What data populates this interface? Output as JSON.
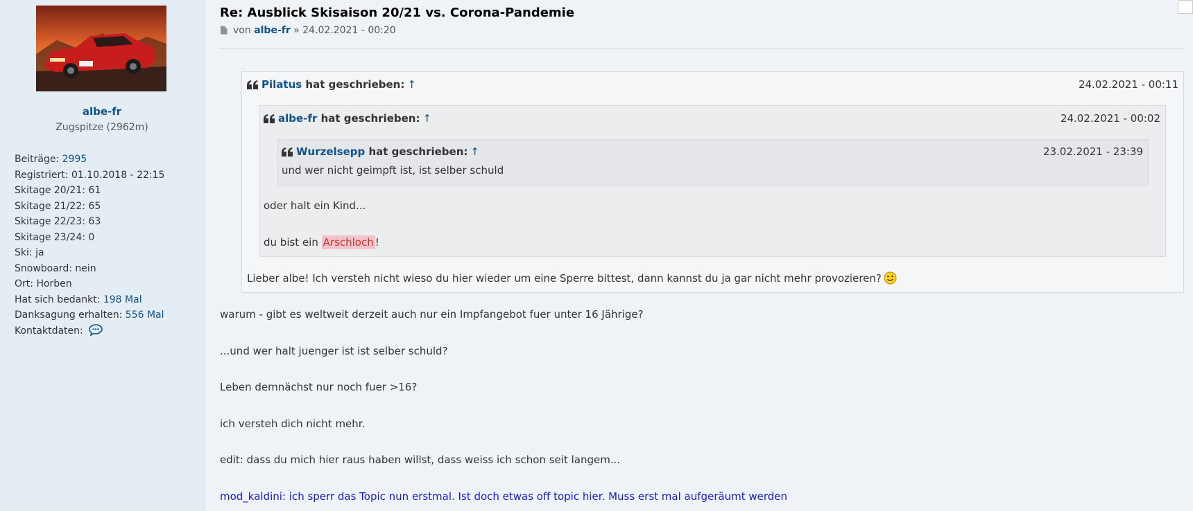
{
  "profile": {
    "username": "albe-fr",
    "rank": "Zugspitze (2962m)",
    "fields": [
      {
        "label": "Beiträge:",
        "value": "2995",
        "link": true
      },
      {
        "label": "Registriert:",
        "value": "01.10.2018 - 22:15",
        "link": false
      },
      {
        "label": "Skitage 20/21:",
        "value": "61",
        "link": false
      },
      {
        "label": "Skitage 21/22:",
        "value": "65",
        "link": false
      },
      {
        "label": "Skitage 22/23:",
        "value": "63",
        "link": false
      },
      {
        "label": "Skitage 23/24:",
        "value": "0",
        "link": false
      },
      {
        "label": "Ski:",
        "value": "ja",
        "link": false
      },
      {
        "label": "Snowboard:",
        "value": "nein",
        "link": false
      },
      {
        "label": "Ort:",
        "value": "Horben",
        "link": false
      },
      {
        "label": "Hat sich bedankt:",
        "value": "198 Mal",
        "link": true
      },
      {
        "label": "Danksagung erhalten:",
        "value": "556 Mal",
        "link": true
      }
    ],
    "contact_label": "Kontaktdaten:",
    "contact_icon": "chat-bubble-icon"
  },
  "post": {
    "title": "Re: Ausblick Skisaison 20/21 vs. Corona-Pandemie",
    "meta_prefix": "von",
    "author": "albe-fr",
    "meta_sep": "»",
    "date": "24.02.2021 - 00:20"
  },
  "quotes": {
    "q1": {
      "author": "Pilatus",
      "suffix": "hat geschrieben:",
      "arrow": "↑",
      "date": "24.02.2021 - 00:11",
      "text": "Lieber albe! Ich versteh nicht wieso du hier wieder um eine Sperre bittest, dann kannst du ja gar nicht mehr provozieren?"
    },
    "q2": {
      "author": "albe-fr",
      "suffix": "hat geschrieben:",
      "arrow": "↑",
      "date": "24.02.2021 - 00:02",
      "line1": "oder halt ein Kind...",
      "line2_pre": "du bist ein",
      "bad_word": "Arschloch",
      "line2_post": "!"
    },
    "q3": {
      "author": "Wurzelsepp",
      "suffix": "hat geschrieben:",
      "arrow": "↑",
      "date": "23.02.2021 - 23:39",
      "text": "und wer nicht geimpft ist, ist selber schuld"
    }
  },
  "body": {
    "p1": "warum - gibt es weltweit derzeit auch nur ein Impfangebot fuer unter 16 Jährige?",
    "p2": "...und wer halt juenger ist ist selber schuld?",
    "p3": "Leben demnächst nur noch fuer >16?",
    "p4": "ich versteh dich nicht mehr.",
    "p5": "edit: dass du mich hier raus haben willst, dass weiss ich schon seit langem...",
    "mod": "mod_kaldini: ich sperr das Topic nun erstmal. Ist doch etwas off topic hier. Muss erst mal aufgeräumt werden"
  },
  "colors": {
    "link": "#105289",
    "mod": "#1a1acc",
    "background": "#eef3f7",
    "sidebar": "#e4edf4"
  }
}
